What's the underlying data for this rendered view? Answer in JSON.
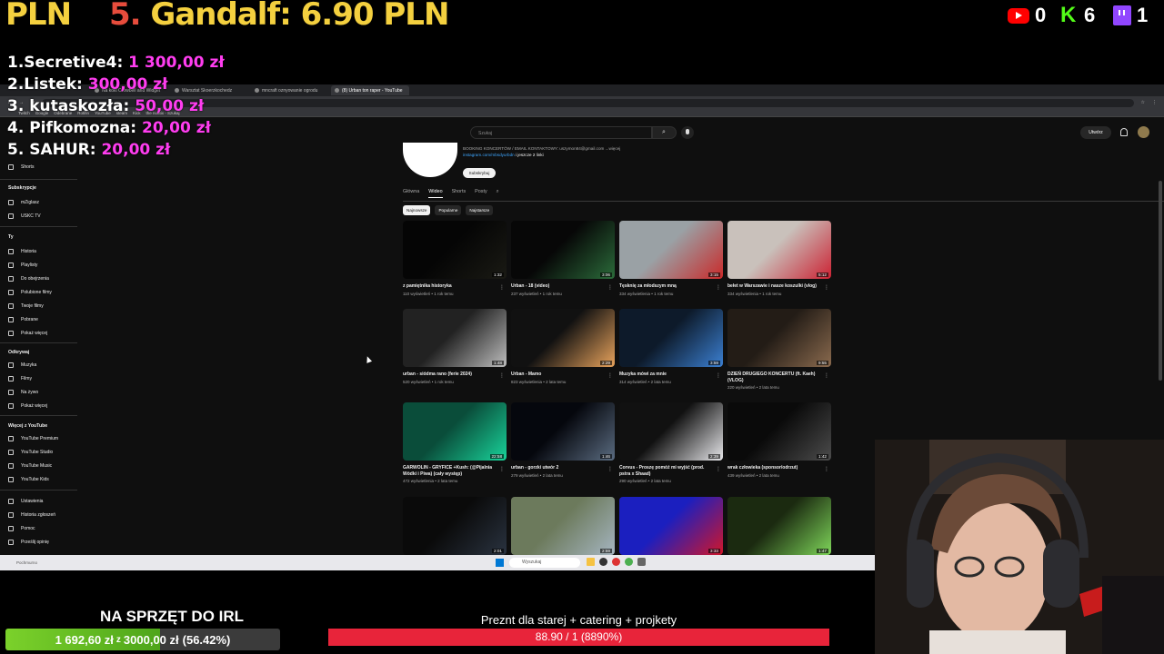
{
  "overlay": {
    "top_left": "PLN",
    "top_gandalf_rank": "5.",
    "top_gandalf_text": "Gandalf: 6.90 PLN",
    "youtube_count": "0",
    "kick_count": "6",
    "twitch_count": "1",
    "donors": [
      {
        "name": "1.Secretive4:",
        "amount": "1 300,00 zł"
      },
      {
        "name": "2.Listek:",
        "amount": "300,00 zł"
      },
      {
        "name": "3. kutaskozła:",
        "amount": "50,00 zł"
      },
      {
        "name": "4. Pifkomozna:",
        "amount": "20,00 zł"
      },
      {
        "name": "5. SAHUR:",
        "amount": "20,00 zł"
      }
    ],
    "goal1_title": "NA SPRZĘT DO IRL",
    "goal1_current": "1 692,60 zł",
    "goal1_sep": "z",
    "goal1_target": "3000,00 zł",
    "goal1_percent_text": "(56.42%)",
    "goal1_fraction": 0.5642,
    "goal2_title": "Preznt dla starej + catering + projkety",
    "goal2_text": "88.90 / 1 (8890%)"
  },
  "browser": {
    "tabs": [
      {
        "label": "Na koki Crowbell and Widget",
        "active": false
      },
      {
        "label": "Warsztat Skoerzkochedz",
        "active": false
      },
      {
        "label": "mncraft oznyowanie ogrodu",
        "active": false
      },
      {
        "label": "(8) Urban ton raper - YouTube",
        "active": true
      }
    ],
    "bookmarks": [
      "Twitch",
      "Google",
      "Odebrane",
      "Rotifin",
      "YouTube",
      "steam",
      "Kick",
      "the nodtix - Szukaj"
    ]
  },
  "youtube": {
    "search_placeholder": "Szukaj",
    "create_label": "Utwórz",
    "sidebar": {
      "shorts": "Shorts",
      "subs_head": "Subskrypcje",
      "subs": [
        "mZiglasz",
        "USKC TV"
      ],
      "you_head": "Ty",
      "you_items": [
        "Historia",
        "Playlisty",
        "Do obejrzenia",
        "Polubione filmy",
        "Twoje filmy",
        "Pobrane",
        "Pokaż więcej"
      ],
      "explore_head": "Odkrywaj",
      "explore_items": [
        "Muzyka",
        "Filmy",
        "Na żywo",
        "Pokaż więcej"
      ],
      "more_head": "Więcej z YouTube",
      "more_items": [
        "YouTube Premium",
        "YouTube Studio",
        "YouTube Music",
        "YouTube Kids"
      ],
      "settings_items": [
        "Ustawienia",
        "Historia zgłoszeń",
        "Pomoc",
        "Prześlij opinię"
      ]
    },
    "channel": {
      "info_line": "BOOKING KONCERTÓW / EMAIL KONTAKTOWY: uszymon84@gmail.com ...więcej",
      "link_line": "instagram.com/mbsdyurbdn",
      "link_more": "i jeszcze 2 linki",
      "subscribe": "Subskrybuj",
      "tabs": [
        "Główna",
        "Wideo",
        "Shorts",
        "Posty"
      ],
      "chips": [
        "Najnowsze",
        "Popularne",
        "Najstarsze"
      ]
    },
    "videos": [
      {
        "title": "z pamiętnika historyka",
        "meta": "110 wyświetleń • 1 rok temu",
        "dur": "1:32",
        "c1": "#050505",
        "c2": "#1a1a14"
      },
      {
        "title": "Urban - 18 (video)",
        "meta": "237 wyświetleń • 1 rok temu",
        "dur": "3:06",
        "c1": "#070707",
        "c2": "#2b6b3a"
      },
      {
        "title": "Tęsknię za młodszym mną",
        "meta": "334 wyświetlenia • 1 rok temu",
        "dur": "3:15",
        "c1": "#9aa1a5",
        "c2": "#c92a2a"
      },
      {
        "title": "bełet w Warszawie i nasze koszulki (vlog)",
        "meta": "334 wyświetlenia • 1 rok temu",
        "dur": "5:12",
        "c1": "#c9c1bb",
        "c2": "#cc2233"
      },
      {
        "title": "urban - siódma rano (ferie 2024)",
        "meta": "520 wyświetleń • 1 rok temu",
        "dur": "1:48",
        "c1": "#222",
        "c2": "#bdbdbd"
      },
      {
        "title": "Urban - Mamo",
        "meta": "823 wyświetlenia • 2 lata temu",
        "dur": "2:29",
        "c1": "#111",
        "c2": "#e8a35c"
      },
      {
        "title": "Muzyka mówi za mnie",
        "meta": "314 wyświetleń • 2 lata temu",
        "dur": "3:59",
        "c1": "#0d1a2a",
        "c2": "#3b7fd1"
      },
      {
        "title": "DZIEŃ DRUGIEGO KONCERTU (ft. Kaeh) (VLOG)",
        "meta": "220 wyświetleń • 2 lata temu",
        "dur": "9:55",
        "c1": "#231c16",
        "c2": "#8a6a4e"
      },
      {
        "title": "GARWOLIN - GRYFICE +Kush: (@Pijalnia Wódki i Piwa) (cały występ)",
        "meta": "472 wyświetlenia • 2 lata temu",
        "dur": "22:58",
        "c1": "#0a4d3a",
        "c2": "#19d39a"
      },
      {
        "title": "urban - gorzki utwór 2",
        "meta": "279 wyświetleń • 2 lata temu",
        "dur": "1:46",
        "c1": "#05070d",
        "c2": "#5a6b80"
      },
      {
        "title": "Corvus - Proszę pomóż mi wyjść (prod. pstra x Shaad)",
        "meta": "290 wyświetleń • 2 lata temu",
        "dur": "2:39",
        "c1": "#111",
        "c2": "#e7e7ea"
      },
      {
        "title": "wrak człowieka (sponsor/odrzut)",
        "meta": "439 wyświetleń • 2 lata temu",
        "dur": "1:42",
        "c1": "#0a0a0a",
        "c2": "#4c4c4c"
      },
      {
        "title": "",
        "meta": "",
        "dur": "2:01",
        "c1": "#0a0a0a",
        "c2": "#2a3340"
      },
      {
        "title": "",
        "meta": "",
        "dur": "2:59",
        "c1": "#6c7a5c",
        "c2": "#a5b5c0"
      },
      {
        "title": "",
        "meta": "",
        "dur": "3:33",
        "c1": "#1b1fbf",
        "c2": "#d1162a"
      },
      {
        "title": "",
        "meta": "",
        "dur": "1:47",
        "c1": "#1b2a10",
        "c2": "#7fd65a"
      }
    ]
  },
  "taskbar": {
    "search": "Wyszukaj",
    "weather": "Pochmurno"
  },
  "colors": {
    "donor_amount": "#ff3df0",
    "goal_fill": "#7bd12b",
    "goal2_bar": "#e8243a",
    "top_text": "#f4d03f"
  }
}
